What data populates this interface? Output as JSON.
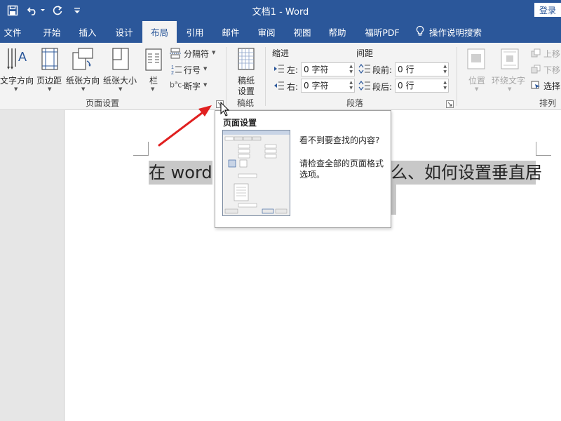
{
  "titlebar": {
    "title": "文档1  -  Word",
    "login": "登录",
    "icons": [
      "save-icon",
      "undo-icon",
      "redo-icon",
      "customize-icon"
    ]
  },
  "tabs": [
    "文件",
    "开始",
    "插入",
    "设计",
    "布局",
    "引用",
    "邮件",
    "审阅",
    "视图",
    "帮助",
    "福昕PDF"
  ],
  "active_tab": "布局",
  "search": {
    "label": "操作说明搜索"
  },
  "ribbon": {
    "page_setup": {
      "text_direction": "文字方向",
      "margins": "页边距",
      "orientation": "纸张方向",
      "size": "纸张大小",
      "columns": "栏",
      "breaks": "分隔符",
      "line_numbers": "行号",
      "hyphenation": "断字",
      "group_label": "页面设置"
    },
    "manuscript": {
      "settings_line1": "稿纸",
      "settings_line2": "设置",
      "group_label": "稿纸"
    },
    "paragraph": {
      "indent_header": "缩进",
      "spacing_header": "间距",
      "left_label": "左:",
      "left_value": "0 字符",
      "right_label": "右:",
      "right_value": "0 字符",
      "before_label": "段前:",
      "before_value": "0 行",
      "after_label": "段后:",
      "after_value": "0 行",
      "group_label": "段落"
    },
    "arrange": {
      "position": "位置",
      "wrap_text": "环绕文字",
      "bring_forward": "上移",
      "send_backward": "下移",
      "selection_pane": "选择",
      "group_label": "排列"
    }
  },
  "document": {
    "text_left": "在 word",
    "text_right": "么、如何设置垂直居"
  },
  "tooltip": {
    "title": "页面设置",
    "line1": "看不到要查找的内容?",
    "line2": "请检查全部的页面格式",
    "line3": "选项。"
  },
  "colors": {
    "brand": "#2b579a",
    "arrow": "#e02020",
    "highlight": "#c8c8c8"
  }
}
